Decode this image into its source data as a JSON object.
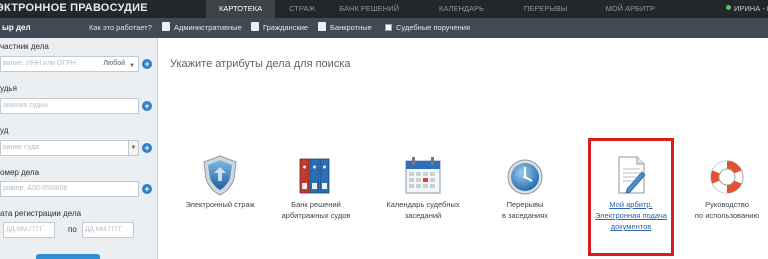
{
  "header": {
    "brand": "ЭКТРОННОЕ ПРАВОСУДИЕ",
    "nav": [
      "КАРТОТЕКА",
      "СТРАЖ",
      "БАНК РЕШЕНИЙ",
      "КАЛЕНДАРЬ",
      "ПЕРЕРЫВЫ",
      "МОЙ АРБИТР"
    ],
    "user": "ИРИНА - В"
  },
  "subbar": {
    "title": "ыр дел",
    "howto": "Как это работает?",
    "filters": [
      "Административные",
      "Гражданские",
      "Банкротные",
      "Судебные поручения"
    ]
  },
  "sidebar": {
    "participant_label": "частник дела",
    "participant_placeholder": "вание, ИНН или ОГРН",
    "participant_select": "Любой",
    "judge_label": "удья",
    "judge_placeholder": "амилия судьи",
    "court_label": "уд",
    "court_placeholder": "вание суда",
    "case_label": "омер дела",
    "case_placeholder": "ример, А50-5568/08",
    "reg_date_label": "ата регистрации дела",
    "date_from_placeholder": "ДД.ММ.ГГГГ",
    "date_sep": "по",
    "date_to_placeholder": "ДД.ММ.ГГГГ"
  },
  "main": {
    "title": "Укажите атрибуты дела для поиска",
    "tiles": [
      {
        "line1": "Электронный страж",
        "line2": "",
        "line3": "",
        "icon": "shield-icon"
      },
      {
        "line1": "Банк решений",
        "line2": "арбитражных судов",
        "line3": "",
        "icon": "binders-icon"
      },
      {
        "line1": "Календарь судебных",
        "line2": "заседаний",
        "line3": "",
        "icon": "calendar-icon"
      },
      {
        "line1": "Перерывы",
        "line2": "в заседаниях",
        "line3": "",
        "icon": "clock-icon"
      },
      {
        "line1": "Мой арбитр.",
        "line2": "Электронная подача",
        "line3": "документов",
        "icon": "document-pen-icon"
      },
      {
        "line1": "Руководство",
        "line2": "по использованию",
        "line3": "",
        "icon": "lifebuoy-icon"
      }
    ]
  },
  "colors": {
    "header_bg": "#23272b",
    "subbar_bg": "#3f4a55",
    "accent": "#2f7fc4",
    "highlight": "#d71e1e"
  }
}
